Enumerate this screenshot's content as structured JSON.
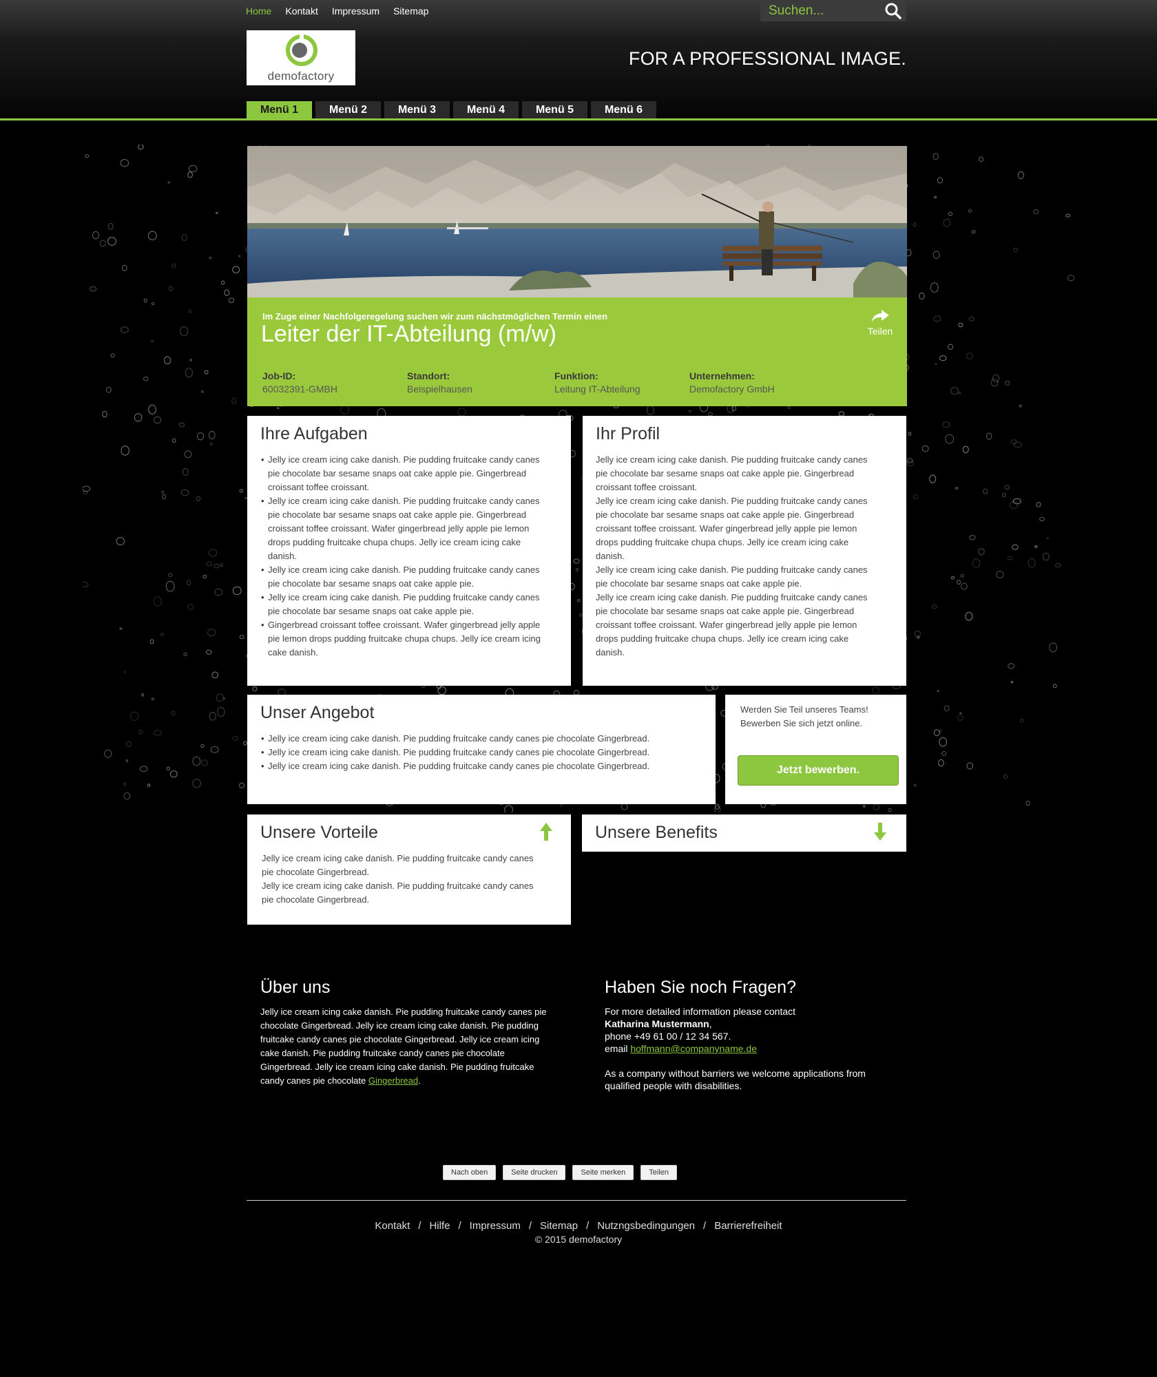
{
  "topnav": {
    "home": "Home",
    "kontakt": "Kontakt",
    "impressum": "Impressum",
    "sitemap": "Sitemap"
  },
  "search": {
    "placeholder": "Suchen..."
  },
  "logo": {
    "text": "demofactory"
  },
  "tagline": "FOR A PROFESSIONAL IMAGE.",
  "mainnav": [
    "Menü 1",
    "Menü 2",
    "Menü 3",
    "Menü 4",
    "Menü 5",
    "Menü 6"
  ],
  "hero": {
    "intro": "Im Zuge einer Nachfolgeregelung suchen wir zum nächstmöglichen Termin einen",
    "title": "Leiter der IT-Abteilung (m/w)",
    "share": "Teilen",
    "meta": [
      {
        "key": "Job-ID:",
        "value": "60032391-GMBH"
      },
      {
        "key": "Standort:",
        "value": "Beispielhausen"
      },
      {
        "key": "Funktion:",
        "value": "Leitung IT-Abteilung"
      },
      {
        "key": "Unternehmen:",
        "value": "Demofactory GmbH"
      }
    ]
  },
  "aufgaben": {
    "title": "Ihre Aufgaben",
    "items": [
      "Jelly ice cream icing cake danish. Pie pudding fruitcake candy canes pie chocolate bar sesame snaps oat cake apple pie. Gingerbread croissant toffee croissant.",
      "Jelly ice cream icing cake danish. Pie pudding fruitcake candy canes pie chocolate bar sesame snaps oat cake apple pie. Gingerbread croissant toffee croissant. Wafer gingerbread jelly apple pie lemon drops pudding fruitcake chupa chups. Jelly ice cream icing cake danish.",
      "Jelly ice cream icing cake danish. Pie pudding fruitcake candy canes pie chocolate bar sesame snaps oat cake apple pie.",
      "Jelly ice cream icing cake danish. Pie pudding fruitcake candy canes pie chocolate bar sesame snaps oat cake apple pie.",
      "Gingerbread croissant toffee croissant. Wafer gingerbread jelly apple pie lemon drops pudding fruitcake chupa chups. Jelly ice cream icing cake danish."
    ]
  },
  "profil": {
    "title": "Ihr Profil",
    "paragraphs": [
      "Jelly ice cream icing cake danish. Pie pudding fruitcake candy canes pie chocolate bar sesame snaps oat cake apple pie. Gingerbread croissant toffee croissant.",
      "Jelly ice cream icing cake danish. Pie pudding fruitcake candy canes pie chocolate bar sesame snaps oat cake apple pie. Gingerbread croissant toffee croissant. Wafer gingerbread jelly apple pie lemon drops pudding fruitcake chupa chups. Jelly ice cream icing cake danish.",
      "Jelly ice cream icing cake danish. Pie pudding fruitcake candy canes pie chocolate bar sesame snaps oat cake apple pie.",
      "Jelly ice cream icing cake danish. Pie pudding fruitcake candy canes pie chocolate bar sesame snaps oat cake apple pie. Gingerbread croissant toffee croissant. Wafer gingerbread jelly apple pie lemon drops pudding fruitcake chupa chups. Jelly ice cream icing cake danish."
    ]
  },
  "angebot": {
    "title": "Unser Angebot",
    "items": [
      "Jelly ice cream icing cake danish. Pie pudding fruitcake candy canes pie chocolate Gingerbread.",
      "Jelly ice cream icing cake danish. Pie pudding fruitcake candy canes pie chocolate Gingerbread.",
      "Jelly ice cream icing cake danish. Pie pudding fruitcake candy canes pie chocolate Gingerbread."
    ]
  },
  "apply": {
    "line1": "Werden Sie Teil unseres Teams!",
    "line2": "Bewerben Sie sich jetzt online.",
    "button": "Jetzt bewerben."
  },
  "vorteile": {
    "title": "Unsere Vorteile",
    "paragraphs": [
      "Jelly ice cream icing cake danish. Pie pudding fruitcake candy canes pie chocolate Gingerbread.",
      "Jelly ice cream icing cake danish. Pie pudding fruitcake candy canes pie chocolate Gingerbread."
    ]
  },
  "benefits": {
    "title": "Unsere Benefits"
  },
  "about": {
    "title": "Über uns",
    "text": "Jelly ice cream icing cake danish. Pie pudding fruitcake candy canes pie chocolate Gingerbread. Jelly ice cream icing cake danish. Pie pudding fruitcake candy canes pie chocolate Gingerbread. Jelly ice cream icing cake danish. Pie pudding fruitcake candy canes pie chocolate Gingerbread. Jelly ice cream icing cake danish. Pie pudding fruitcake candy canes pie chocolate",
    "link": "Gingerbread",
    "end": "."
  },
  "contact": {
    "title": "Haben Sie noch Fragen?",
    "intro": "For more detailed information please contact",
    "name": "Katharina Mustermann",
    "comma": ",",
    "phone": "phone +49 61 00 / 12 34 567.",
    "email_label": "email",
    "email": "hoffmann@companyname.de",
    "note": "As a company without barriers we welcome applications from qualified people with disabilities."
  },
  "footer_buttons": [
    "Nach oben",
    "Seite drucken",
    "Seite merken",
    "Teilen"
  ],
  "footer_links": [
    "Kontakt",
    "Hilfe",
    "Impressum",
    "Sitemap",
    "Nutzngsbedingungen",
    "Barrierefreiheit"
  ],
  "copyright": "© 2015 demofactory",
  "colors": {
    "accent": "#8dc63f",
    "band": "#9bc93c",
    "background": "#000000"
  }
}
